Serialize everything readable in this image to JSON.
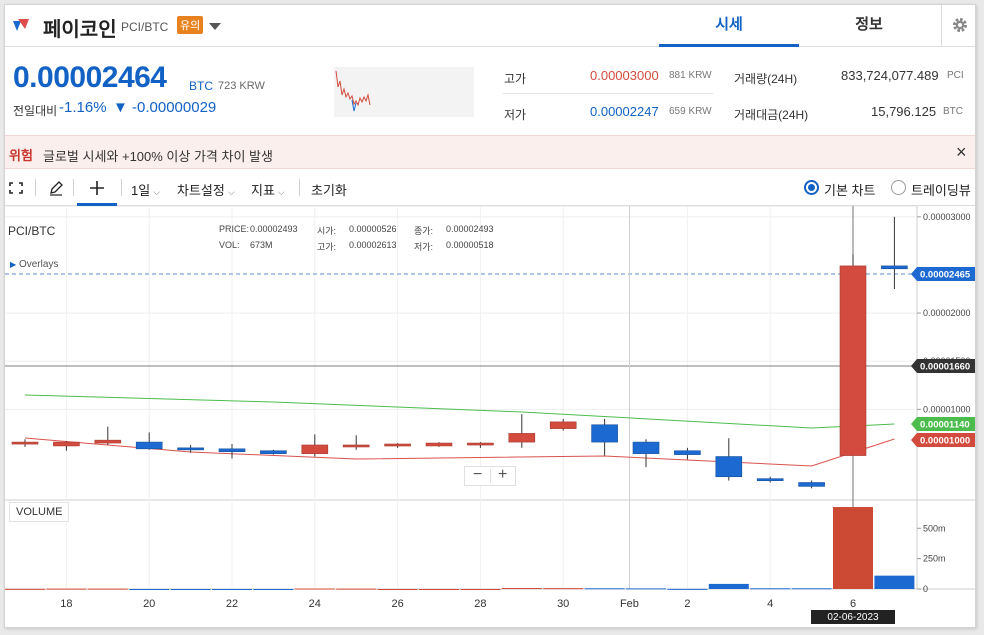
{
  "header": {
    "coin_name": "페이코인",
    "pair": "PCI/BTC",
    "badge": "유의",
    "tabs": [
      {
        "label": "시세"
      },
      {
        "label": "정보"
      }
    ]
  },
  "price": {
    "value": "0.00002464",
    "unit": "BTC",
    "krw": "723 KRW",
    "change_label": "전일대비",
    "change_pct": "-1.16%",
    "change_val": "▼ -0.00000029"
  },
  "stats": {
    "high_label": "고가",
    "high_value": "0.00003000",
    "high_krw": "881 KRW",
    "low_label": "저가",
    "low_value": "0.00002247",
    "low_krw": "659 KRW",
    "volume_label": "거래량(24H)",
    "volume_value": "833,724,077.489",
    "volume_unit": "PCI",
    "amount_label": "거래대금(24H)",
    "amount_value": "15,796.125",
    "amount_unit": "BTC"
  },
  "warning": {
    "tag": "위험",
    "message": "글로벌 시세와 +100% 이상 가격 차이 발생",
    "close": "×"
  },
  "toolbar": {
    "interval": "1일",
    "chart_settings": "차트설정",
    "indicator": "지표",
    "reset": "초기화",
    "basic_chart": "기본 차트",
    "tradingview": "트레이딩뷰",
    "chevron": "⌵"
  },
  "chart_info": {
    "symbol": "PCI/BTC",
    "overlays": "Overlays",
    "price_label": "PRICE:",
    "price_value": "0.00002493",
    "open_label": "시가:",
    "open_value": "0.00000526",
    "close_label": "종가:",
    "close_value": "0.00002493",
    "vol_label": "VOL:",
    "vol_value": "673M",
    "high_label": "고가:",
    "high_value": "0.00002613",
    "low_label": "저가:",
    "low_value": "0.00000518",
    "volume_tag": "VOLUME",
    "zoom_minus": "−",
    "zoom_plus": "+",
    "crosshair_date": "02-06-2023"
  },
  "colors": {
    "accent": "#1261c4",
    "up": "#d24b3e",
    "down": "#1c6ad1",
    "warning_bg": "#fbefee",
    "badge": "#e8821e",
    "ma_short": "#d9534f",
    "ma_long": "#4cbd4c"
  },
  "icons": [
    "logo-icon",
    "caret-down-icon",
    "gear-icon",
    "fullscreen-icon",
    "pencil-icon",
    "crosshair-plus-icon",
    "close-icon"
  ],
  "chart_data": {
    "type": "candlestick",
    "x_tick_labels": [
      "18",
      "20",
      "22",
      "24",
      "26",
      "28",
      "30",
      "Feb",
      "2",
      "4",
      "6"
    ],
    "y_tick_labels": [
      "0.00003000",
      "0.00002000",
      "0.00001500",
      "0.00001000"
    ],
    "price_tags": [
      {
        "label": "0.00002465",
        "color": "#1c6ad1"
      },
      {
        "label": "0.00001660",
        "color": "#333333"
      },
      {
        "label": "0.00001140",
        "color": "#4cbd4c"
      },
      {
        "label": "0.00001000",
        "color": "#d24b3e"
      }
    ],
    "volume_tick_labels": [
      "500m",
      "250m",
      "0"
    ],
    "candles": [
      {
        "date": "Jan 17",
        "o": 6.5e-06,
        "h": 6.9e-06,
        "l": 6.1e-06,
        "c": 6.6e-06
      },
      {
        "date": "Jan 18",
        "o": 6.2e-06,
        "h": 6.7e-06,
        "l": 5.7e-06,
        "c": 6.6e-06
      },
      {
        "date": "Jan 19",
        "o": 6.5e-06,
        "h": 8.2e-06,
        "l": 6.3e-06,
        "c": 6.8e-06
      },
      {
        "date": "Jan 20",
        "o": 6.6e-06,
        "h": 7.6e-06,
        "l": 5.8e-06,
        "c": 5.9e-06
      },
      {
        "date": "Jan 21",
        "o": 6e-06,
        "h": 6.3e-06,
        "l": 5.5e-06,
        "c": 5.8e-06
      },
      {
        "date": "Jan 22",
        "o": 5.9e-06,
        "h": 6.4e-06,
        "l": 4.9e-06,
        "c": 5.6e-06
      },
      {
        "date": "Jan 23",
        "o": 5.7e-06,
        "h": 5.8e-06,
        "l": 5.3e-06,
        "c": 5.4e-06
      },
      {
        "date": "Jan 24",
        "o": 5.4e-06,
        "h": 7.4e-06,
        "l": 5.1e-06,
        "c": 6.3e-06
      },
      {
        "date": "Jan 25",
        "o": 6.1e-06,
        "h": 7.3e-06,
        "l": 5.8e-06,
        "c": 6.3e-06
      },
      {
        "date": "Jan 26",
        "o": 6.3e-06,
        "h": 6.5e-06,
        "l": 6e-06,
        "c": 6.4e-06
      },
      {
        "date": "Jan 27",
        "o": 6.2e-06,
        "h": 6.6e-06,
        "l": 6.1e-06,
        "c": 6.5e-06
      },
      {
        "date": "Jan 28",
        "o": 6.3e-06,
        "h": 6.6e-06,
        "l": 6e-06,
        "c": 6.5e-06
      },
      {
        "date": "Jan 29",
        "o": 6.6e-06,
        "h": 9.5e-06,
        "l": 6e-06,
        "c": 7.5e-06
      },
      {
        "date": "Jan 30",
        "o": 8e-06,
        "h": 9e-06,
        "l": 7.8e-06,
        "c": 8.7e-06
      },
      {
        "date": "Jan 31",
        "o": 8.4e-06,
        "h": 9e-06,
        "l": 5.2e-06,
        "c": 6.6e-06
      },
      {
        "date": "Feb 1",
        "o": 6.6e-06,
        "h": 6.9e-06,
        "l": 4e-06,
        "c": 5.4e-06
      },
      {
        "date": "Feb 2",
        "o": 5.7e-06,
        "h": 6e-06,
        "l": 4.8e-06,
        "c": 5.3e-06
      },
      {
        "date": "Feb 3",
        "o": 5.1e-06,
        "h": 7e-06,
        "l": 2.6e-06,
        "c": 3e-06
      },
      {
        "date": "Feb 4",
        "o": 2.8e-06,
        "h": 3e-06,
        "l": 2.4e-06,
        "c": 2.6e-06
      },
      {
        "date": "Feb 5",
        "o": 2.4e-06,
        "h": 2.6e-06,
        "l": 1.8e-06,
        "c": 2e-06
      },
      {
        "date": "Feb 6",
        "o": 5.2e-06,
        "h": 2.61e-05,
        "l": 5.2e-06,
        "c": 2.49e-05
      },
      {
        "date": "Feb 7",
        "o": 2.49e-05,
        "h": 3e-05,
        "l": 2.25e-05,
        "c": 2.46e-05
      }
    ],
    "volume": [
      1,
      3,
      3,
      0,
      0,
      0,
      0,
      4,
      3,
      0,
      0,
      0,
      8,
      7,
      6,
      5,
      1,
      42,
      6,
      6,
      675,
      110
    ],
    "ylim": [
      1e-06,
      3.05e-05
    ],
    "volume_ylim": [
      0,
      700
    ]
  }
}
